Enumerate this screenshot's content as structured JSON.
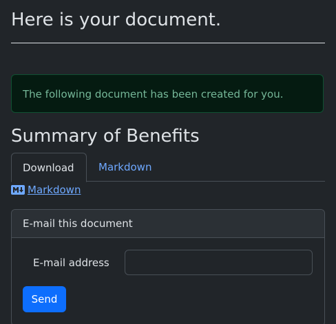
{
  "page": {
    "heading": "Here is your document.",
    "alert_text": "The following document has been created for you.",
    "document_title": "Summary of Benefits"
  },
  "tabs": [
    {
      "label": "Download",
      "active": true
    },
    {
      "label": "Markdown",
      "active": false
    }
  ],
  "markdown_link": {
    "icon": "markdown-icon",
    "label": "Markdown"
  },
  "email_card": {
    "header": "E-mail this document",
    "field_label": "E-mail address",
    "field_value": "",
    "field_placeholder": "",
    "send_label": "Send"
  },
  "colors": {
    "background": "#212529",
    "text": "#dee2e6",
    "link": "#6ea8fe",
    "alert_text": "#75b798",
    "alert_bg": "#051b11",
    "alert_border": "#0f5132",
    "primary_button": "#0d6efd"
  }
}
